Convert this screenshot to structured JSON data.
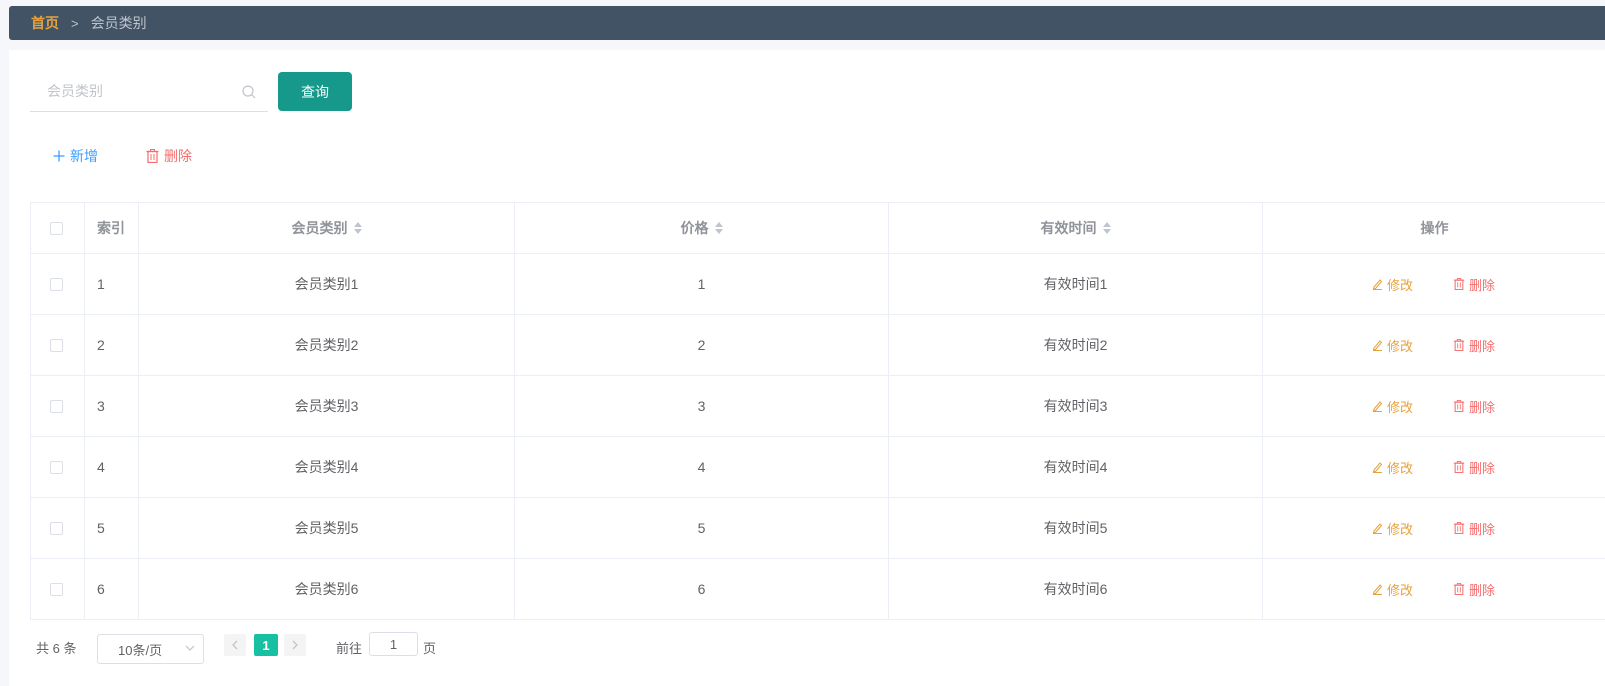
{
  "breadcrumb": {
    "home": "首页",
    "separator": ">",
    "current": "会员类别"
  },
  "search": {
    "placeholder": "会员类别",
    "value": "",
    "button_label": "查询"
  },
  "actions": {
    "add_label": "新增",
    "delete_label": "删除"
  },
  "table": {
    "headers": {
      "index": "索引",
      "category": "会员类别",
      "price": "价格",
      "valid_time": "有效时间",
      "operation": "操作"
    },
    "rows": [
      {
        "index": "1",
        "category": "会员类别1",
        "price": "1",
        "valid_time": "有效时间1"
      },
      {
        "index": "2",
        "category": "会员类别2",
        "price": "2",
        "valid_time": "有效时间2"
      },
      {
        "index": "3",
        "category": "会员类别3",
        "price": "3",
        "valid_time": "有效时间3"
      },
      {
        "index": "4",
        "category": "会员类别4",
        "price": "4",
        "valid_time": "有效时间4"
      },
      {
        "index": "5",
        "category": "会员类别5",
        "price": "5",
        "valid_time": "有效时间5"
      },
      {
        "index": "6",
        "category": "会员类别6",
        "price": "6",
        "valid_time": "有效时间6"
      }
    ],
    "row_edit_label": "修改",
    "row_delete_label": "删除"
  },
  "pagination": {
    "total": "共 6 条",
    "page_size": "10条/页",
    "current_page": "1",
    "goto_label": "前往",
    "goto_value": "1",
    "page_label": "页"
  },
  "colors": {
    "header_bar": "#425366",
    "primary": "#16998a",
    "link": "#409eff",
    "danger": "#f56c6c",
    "warning": "#e6a23c"
  }
}
